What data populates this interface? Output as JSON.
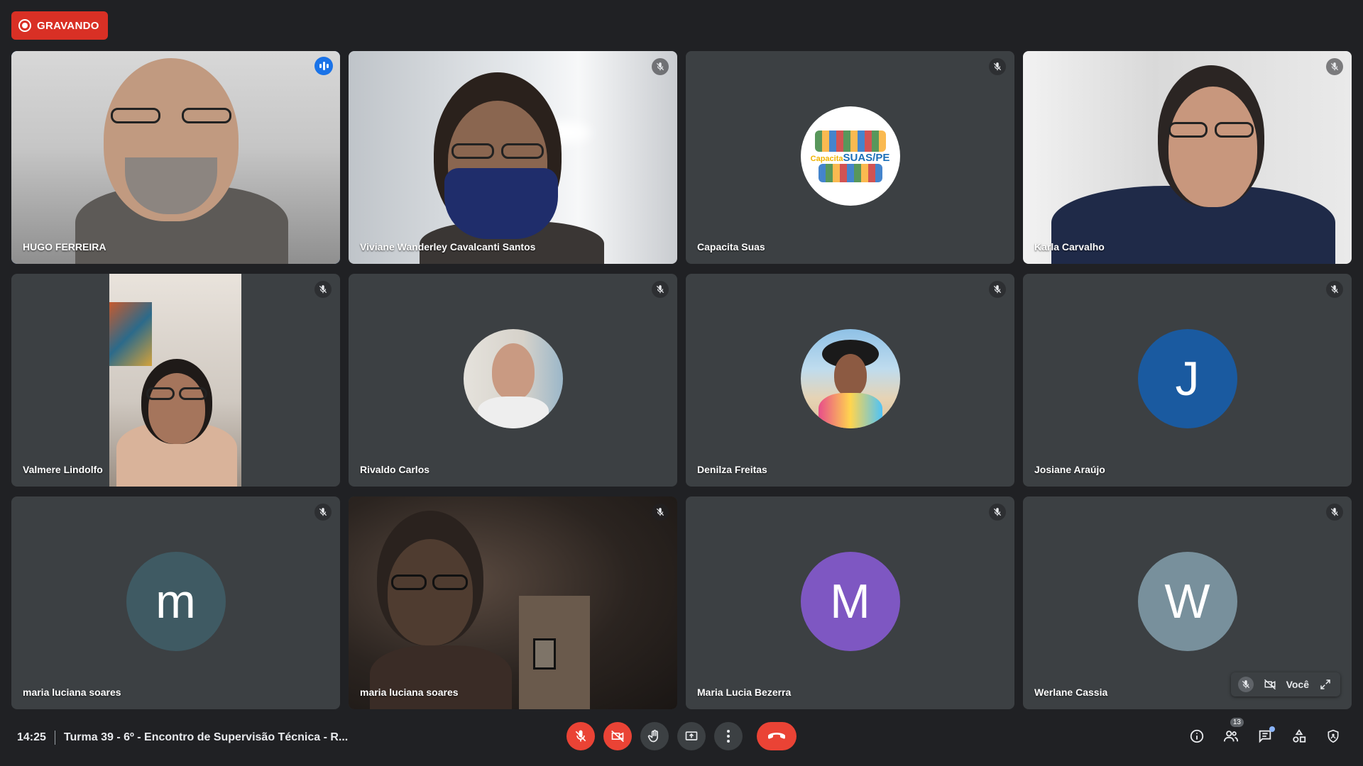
{
  "recording": {
    "label": "GRAVANDO",
    "color": "#d93025"
  },
  "participants": [
    {
      "name": "HUGO FERREIRA",
      "type": "video",
      "speaking": true
    },
    {
      "name": "Viviane Wanderley Cavalcanti Santos",
      "type": "video",
      "muted": true
    },
    {
      "name": "Capacita Suas",
      "type": "logo",
      "muted": true,
      "logo_text_a": "Capacita",
      "logo_text_b": "SUAS/PE"
    },
    {
      "name": "Karla Carvalho",
      "type": "video",
      "muted": true
    },
    {
      "name": "Valmere Lindolfo",
      "type": "video",
      "muted": true
    },
    {
      "name": "Rivaldo Carlos",
      "type": "photo",
      "muted": true
    },
    {
      "name": "Denilza Freitas",
      "type": "photo",
      "muted": true
    },
    {
      "name": "Josiane Araújo",
      "type": "initial",
      "initial": "J",
      "color": "#1a5aa0",
      "muted": true
    },
    {
      "name": "maria luciana soares",
      "type": "initial",
      "initial": "m",
      "color": "#3f5a63",
      "muted": true
    },
    {
      "name": "maria luciana soares",
      "type": "video",
      "muted": true
    },
    {
      "name": "Maria Lucia Bezerra",
      "type": "initial",
      "initial": "M",
      "color": "#7e57c2",
      "muted": true
    },
    {
      "name": "Werlane Cassia",
      "type": "initial",
      "initial": "W",
      "color": "#78909c",
      "muted": true
    }
  ],
  "self_view": {
    "label": "Você"
  },
  "bottom_bar": {
    "time": "14:25",
    "meeting_title": "Turma 39 - 6º - Encontro de Supervisão Técnica - R...",
    "participant_count": "13"
  },
  "icons": {
    "mic_off": "mic-off-icon",
    "camera_off": "camera-off-icon",
    "raise_hand": "raise-hand-icon",
    "present": "present-screen-icon",
    "more": "more-options-icon",
    "end_call": "end-call-icon",
    "info": "info-icon",
    "people": "people-icon",
    "chat": "chat-icon",
    "activities": "activities-icon",
    "host_controls": "host-controls-icon"
  }
}
